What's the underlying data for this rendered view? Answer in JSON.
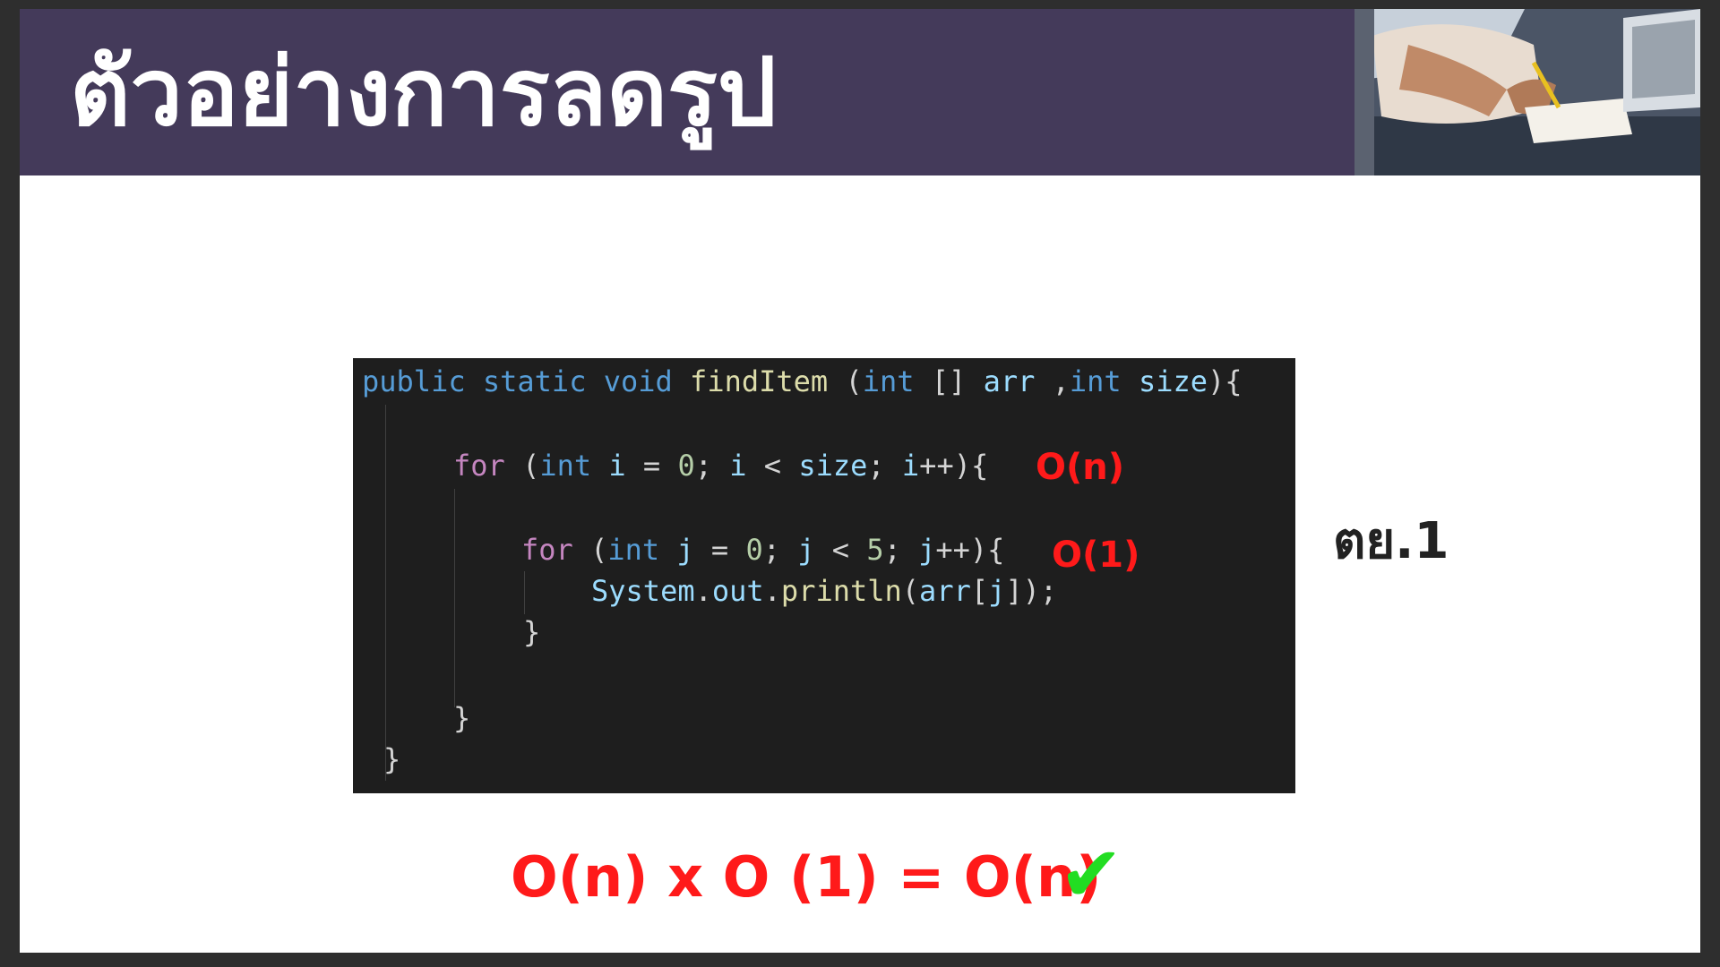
{
  "slide": {
    "title": "ตัวอย่างการลดรูป",
    "side_label": "ตย.1",
    "equation": "O(n) x O (1) = O(n)",
    "check_icon": "check-mark-icon",
    "accent_color": "#ff1a1a",
    "header_color": "#443a5a",
    "check_color": "#22dd22"
  },
  "code": {
    "line1": {
      "t1": "public",
      "t2": " ",
      "t3": "static",
      "t4": " ",
      "t5": "void",
      "t6": " ",
      "t7": "findItem",
      "t8": " (",
      "t9": "int",
      "t10": " [] ",
      "t11": "arr",
      "t12": " ,",
      "t13": "int",
      "t14": " ",
      "t15": "size",
      "t16": "){"
    },
    "line2": {
      "t1": "for",
      "t2": " (",
      "t3": "int",
      "t4": " ",
      "t5": "i",
      "t6": " = ",
      "t7": "0",
      "t8": "; ",
      "t9": "i",
      "t10": " < ",
      "t11": "size",
      "t12": "; ",
      "t13": "i",
      "t14": "++){"
    },
    "line3": {
      "t1": "for",
      "t2": " (",
      "t3": "int",
      "t4": " ",
      "t5": "j",
      "t6": " = ",
      "t7": "0",
      "t8": "; ",
      "t9": "j",
      "t10": " < ",
      "t11": "5",
      "t12": "; ",
      "t13": "j",
      "t14": "++){"
    },
    "line4": {
      "t1": "System",
      "t2": ".",
      "t3": "out",
      "t4": ".",
      "t5": "println",
      "t6": "(",
      "t7": "arr",
      "t8": "[",
      "t9": "j",
      "t10": "]);"
    },
    "line5": "}",
    "line6": "}",
    "line7": "}"
  },
  "annotations": {
    "outer_loop": "O(n)",
    "inner_loop": "O(1)"
  }
}
